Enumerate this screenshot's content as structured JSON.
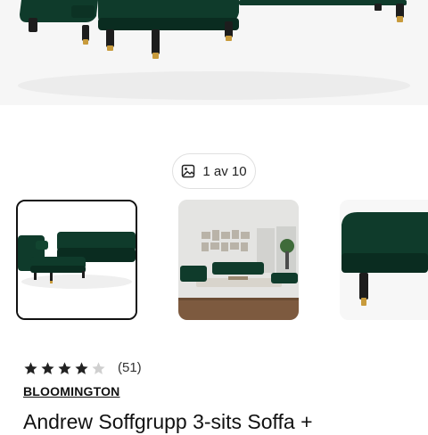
{
  "gallery": {
    "counter_text": "1 av 10",
    "images": [
      {
        "name": "sofa-group-corner-view",
        "selected": true
      },
      {
        "name": "sofa-living-room-view",
        "selected": false
      },
      {
        "name": "ottoman-detail-view",
        "selected": false
      }
    ]
  },
  "product": {
    "rating": 4,
    "rating_max": 5,
    "review_count": "(51)",
    "brand": "BLOOMINGTON",
    "title": "Andrew Soffgrupp 3-sits Soffa +"
  },
  "colors": {
    "velvet": "#0f3b2b",
    "velvet_dark": "#0a2c20",
    "leg": "#1d1d1d",
    "brass": "#c89b3c",
    "star_filled": "#222222",
    "star_empty": "#cfcfcf"
  },
  "icons": {
    "counter": "image-icon",
    "rating": "star-icon"
  }
}
